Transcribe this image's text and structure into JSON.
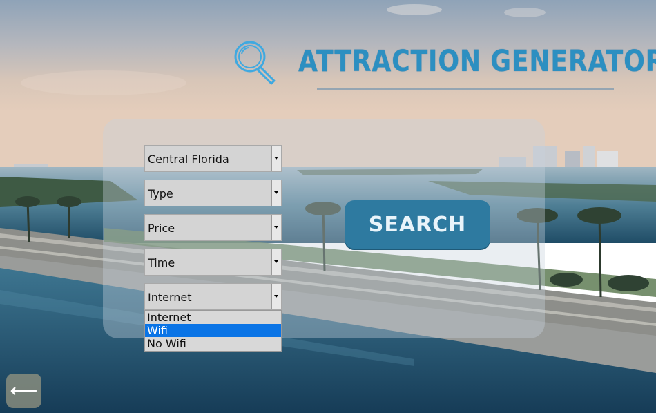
{
  "header": {
    "title": "ATTRACTION GENERATOR",
    "logo_icon": "magnifier-icon"
  },
  "filters": {
    "region": {
      "selected": "Central Florida"
    },
    "type": {
      "selected": "Type"
    },
    "price": {
      "selected": "Price"
    },
    "time": {
      "selected": "Time"
    },
    "internet": {
      "selected": "Internet",
      "options": [
        "Internet",
        "Wifi",
        "No Wifi"
      ],
      "highlighted": "Wifi",
      "open": true
    }
  },
  "search_button": {
    "label": "SEARCH"
  },
  "back_button": {
    "icon": "left-arrow-icon",
    "glyph": "⟵"
  },
  "colors": {
    "title": "#2c8fc1",
    "search_button": "#2e7aa0",
    "option_highlight": "#0a74e6"
  }
}
